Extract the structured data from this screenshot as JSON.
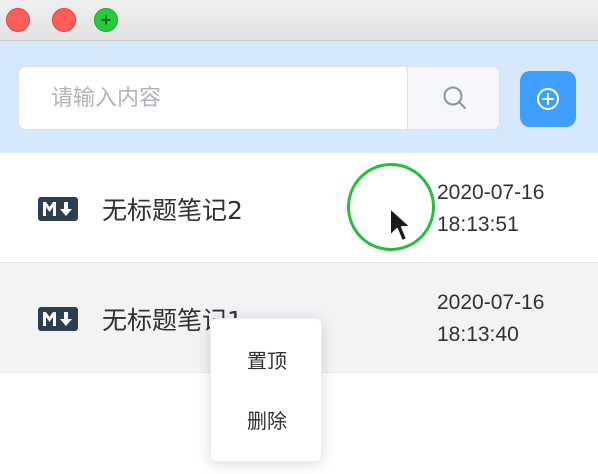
{
  "window": {
    "buttons": [
      "close",
      "minimize",
      "zoom"
    ],
    "colors": {
      "close": "#fc5f57",
      "minimize": "#fc5f57",
      "zoom": "#29c940"
    }
  },
  "search": {
    "placeholder": "请输入内容",
    "value": "",
    "search_icon": "search-icon",
    "add_icon": "plus-circle-icon",
    "accent": "#409eff"
  },
  "notes": [
    {
      "icon": "markdown-icon",
      "title": "无标题笔记2",
      "date": "2020-07-16",
      "time": "18:13:51"
    },
    {
      "icon": "markdown-icon",
      "title": "无标题笔记1",
      "date": "2020-07-16",
      "time": "18:13:40"
    }
  ],
  "context_menu": {
    "items": [
      {
        "label": "置顶"
      },
      {
        "label": "删除"
      }
    ]
  },
  "cursor": {
    "icon": "arrow-cursor-icon",
    "click_indicator_color": "#23c03a"
  }
}
